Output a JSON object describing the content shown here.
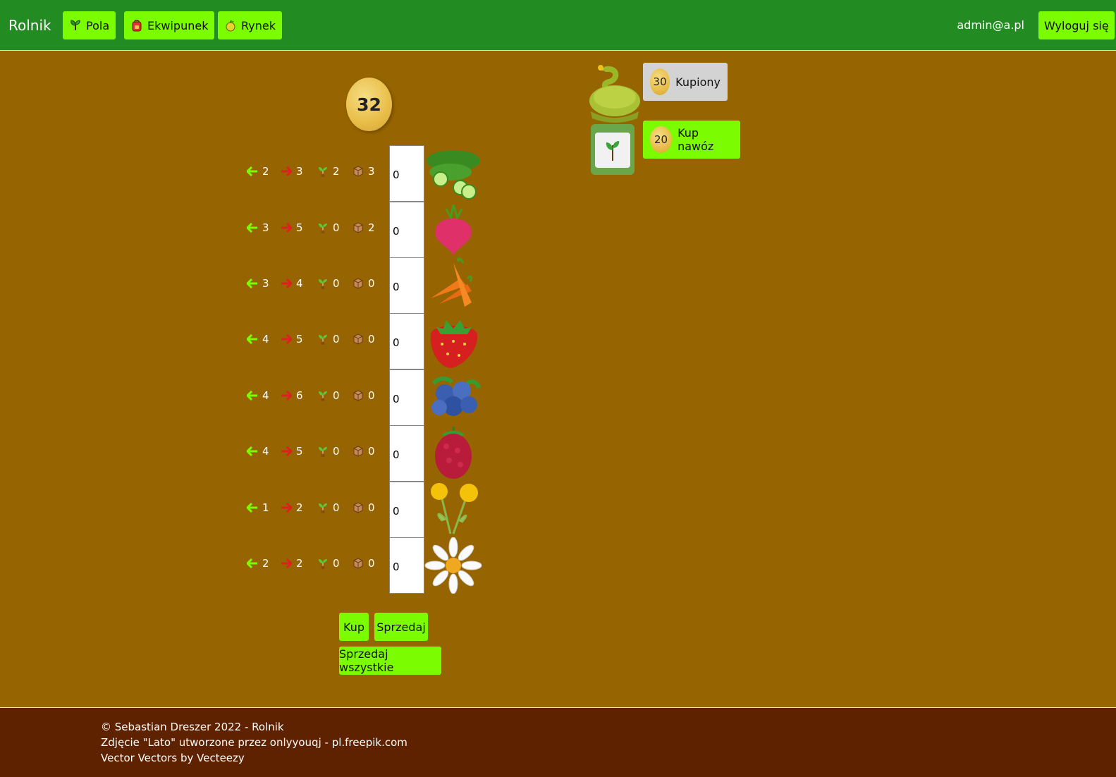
{
  "nav": {
    "brand": "Rolnik",
    "items": [
      {
        "label": "Pola",
        "icon": "plant-icon"
      },
      {
        "label": "Ekwipunek",
        "icon": "backpack-icon"
      },
      {
        "label": "Rynek",
        "icon": "apple-icon"
      }
    ],
    "user": "admin@a.pl",
    "logout": "Wyloguj się"
  },
  "balance": "32",
  "crops": [
    {
      "name": "cucumber",
      "left": "2",
      "right": "3",
      "seeds": "2",
      "boxes": "3",
      "qty": "0"
    },
    {
      "name": "beet",
      "left": "3",
      "right": "5",
      "seeds": "0",
      "boxes": "2",
      "qty": "0"
    },
    {
      "name": "carrot",
      "left": "3",
      "right": "4",
      "seeds": "0",
      "boxes": "0",
      "qty": "0"
    },
    {
      "name": "strawberry",
      "left": "4",
      "right": "5",
      "seeds": "0",
      "boxes": "0",
      "qty": "0"
    },
    {
      "name": "blueberry",
      "left": "4",
      "right": "6",
      "seeds": "0",
      "boxes": "0",
      "qty": "0"
    },
    {
      "name": "raspberry",
      "left": "4",
      "right": "5",
      "seeds": "0",
      "boxes": "0",
      "qty": "0"
    },
    {
      "name": "dandelion",
      "left": "1",
      "right": "2",
      "seeds": "0",
      "boxes": "0",
      "qty": "0"
    },
    {
      "name": "daisy",
      "left": "2",
      "right": "2",
      "seeds": "0",
      "boxes": "0",
      "qty": "0"
    }
  ],
  "actions": {
    "buy": "Kup",
    "sell": "Sprzedaj",
    "sell_all": "Sprzedaj wszystkie"
  },
  "fertilizers": [
    {
      "price": "30",
      "label": "Kupiony",
      "state": "bought"
    },
    {
      "price": "20",
      "label": "Kup nawóz",
      "state": "buy"
    }
  ],
  "footer": {
    "line1": "© Sebastian Dreszer 2022 - Rolnik",
    "line2": "Zdjęcie \"Lato\" utworzone przez onlyyouqj - pl.freepik.com",
    "line3": "Vector Vectors by Vecteezy"
  },
  "colors": {
    "navbar": "#228b22",
    "button": "#7cfc00",
    "background": "#966400",
    "footer": "#5e2200",
    "coin": "#e8bd47",
    "arrow_left": "#7cfc00",
    "arrow_right": "#e02020",
    "bought": "#d3d3d3"
  }
}
